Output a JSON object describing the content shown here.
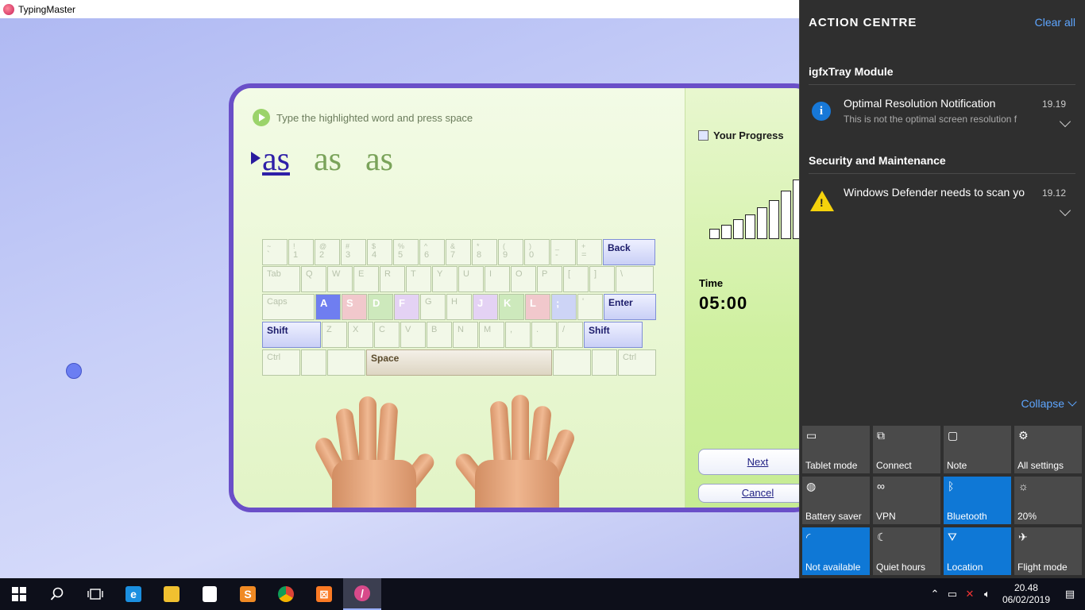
{
  "app": {
    "title": "TypingMaster"
  },
  "lesson": {
    "instruction": "Type the highlighted word and press space",
    "words": [
      "as",
      "as",
      "as"
    ]
  },
  "keyboard": {
    "rows": [
      [
        {
          "top": "~",
          "label": "`"
        },
        {
          "top": "!",
          "label": "1"
        },
        {
          "top": "@",
          "label": "2"
        },
        {
          "top": "#",
          "label": "3"
        },
        {
          "top": "$",
          "label": "4"
        },
        {
          "top": "%",
          "label": "5"
        },
        {
          "top": "^",
          "label": "6"
        },
        {
          "top": "&",
          "label": "7"
        },
        {
          "top": "*",
          "label": "8"
        },
        {
          "top": "(",
          "label": "9"
        },
        {
          "top": ")",
          "label": "0"
        },
        {
          "top": "_",
          "label": "-"
        },
        {
          "top": "+",
          "label": "="
        },
        {
          "label": "Back",
          "cls": "big ww"
        }
      ],
      [
        {
          "label": "Tab",
          "cls": "w"
        },
        {
          "label": "Q"
        },
        {
          "label": "W"
        },
        {
          "label": "E"
        },
        {
          "label": "R"
        },
        {
          "label": "T"
        },
        {
          "label": "Y"
        },
        {
          "label": "U"
        },
        {
          "label": "I"
        },
        {
          "label": "O"
        },
        {
          "label": "P"
        },
        {
          "label": "["
        },
        {
          "label": "]"
        },
        {
          "label": "\\",
          "cls": "w"
        }
      ],
      [
        {
          "label": "Caps",
          "cls": "ww"
        },
        {
          "label": "A",
          "cls": "hl kA"
        },
        {
          "label": "S",
          "cls": "hl kS"
        },
        {
          "label": "D",
          "cls": "hl kD"
        },
        {
          "label": "F",
          "cls": "hl kF"
        },
        {
          "label": "G"
        },
        {
          "label": "H"
        },
        {
          "label": "J",
          "cls": "hl kJ"
        },
        {
          "label": "K",
          "cls": "hl kK"
        },
        {
          "label": "L",
          "cls": "hl kL"
        },
        {
          "label": ";",
          "cls": "hl kSC"
        },
        {
          "label": "'"
        },
        {
          "label": "Enter",
          "cls": "big ww"
        }
      ],
      [
        {
          "label": "Shift",
          "cls": "big www"
        },
        {
          "label": "Z"
        },
        {
          "label": "X"
        },
        {
          "label": "C"
        },
        {
          "label": "V"
        },
        {
          "label": "B"
        },
        {
          "label": "N"
        },
        {
          "label": "M"
        },
        {
          "label": ","
        },
        {
          "label": "."
        },
        {
          "label": "/"
        },
        {
          "label": "Shift",
          "cls": "big www"
        }
      ],
      [
        {
          "label": "Ctrl",
          "cls": "w"
        },
        {
          "label": ""
        },
        {
          "label": "",
          "cls": "w"
        },
        {
          "label": "Space",
          "cls": "space"
        },
        {
          "label": "",
          "cls": "w"
        },
        {
          "label": ""
        },
        {
          "label": "Ctrl",
          "cls": "w"
        }
      ]
    ]
  },
  "progress": {
    "title": "Your Progress",
    "bar_values": [
      1,
      1.4,
      1.9,
      2.4,
      3.1,
      3.8,
      4.7,
      5.8,
      6.8
    ],
    "time_label": "Time",
    "time_value": "05:00",
    "next_label": "Next",
    "cancel_label": "Cancel"
  },
  "action_centre": {
    "title": "ACTION CENTRE",
    "clear_all": "Clear all",
    "groups": [
      {
        "name": "igfxTray Module",
        "notification": {
          "icon": "info-icon",
          "title": "Optimal Resolution Notification",
          "subtitle": "This is not the optimal screen resolution f",
          "time": "19.19"
        }
      },
      {
        "name": "Security and Maintenance",
        "notification": {
          "icon": "warning-icon",
          "title": "Windows Defender needs to scan yo",
          "subtitle": "",
          "time": "19.12"
        }
      }
    ],
    "collapse": "Collapse",
    "tiles": [
      {
        "label": "Tablet mode",
        "icon": "tablet-icon",
        "glyph": "▭",
        "on": false
      },
      {
        "label": "Connect",
        "icon": "connect-icon",
        "glyph": "⧉",
        "on": false
      },
      {
        "label": "Note",
        "icon": "note-icon",
        "glyph": "▢",
        "on": false
      },
      {
        "label": "All settings",
        "icon": "gear-icon",
        "glyph": "⚙",
        "on": false
      },
      {
        "label": "Battery saver",
        "icon": "battery-saver-icon",
        "glyph": "◍",
        "on": false
      },
      {
        "label": "VPN",
        "icon": "vpn-icon",
        "glyph": "∞",
        "on": false
      },
      {
        "label": "Bluetooth",
        "icon": "bluetooth-icon",
        "glyph": "ᛒ",
        "on": true
      },
      {
        "label": "20%",
        "icon": "brightness-icon",
        "glyph": "☼",
        "on": false
      },
      {
        "label": "Not available",
        "icon": "wifi-icon",
        "glyph": "◜",
        "on": true
      },
      {
        "label": "Quiet hours",
        "icon": "moon-icon",
        "glyph": "☾",
        "on": false
      },
      {
        "label": "Location",
        "icon": "location-icon",
        "glyph": "⛛",
        "on": true
      },
      {
        "label": "Flight mode",
        "icon": "airplane-icon",
        "glyph": "✈",
        "on": false
      }
    ]
  },
  "taskbar": {
    "time": "20.48",
    "date": "06/02/2019",
    "apps": [
      {
        "name": "edge-icon",
        "color": "#1b8fe0",
        "glyph": "e"
      },
      {
        "name": "file-explorer-icon",
        "color": "#f0c030",
        "glyph": ""
      },
      {
        "name": "store-icon",
        "color": "#ffffff",
        "glyph": ""
      },
      {
        "name": "sublime-icon",
        "color": "#f08a24",
        "glyph": "S"
      },
      {
        "name": "chrome-icon",
        "color": "#db4437",
        "glyph": ""
      },
      {
        "name": "xampp-icon",
        "color": "#fb7a24",
        "glyph": "⊠"
      },
      {
        "name": "typingmaster-icon",
        "color": "#d84a8a",
        "glyph": "/",
        "active": true
      }
    ]
  },
  "colors": {
    "accent": "#6a4fc8",
    "action_blue": "#0f78d6",
    "link": "#5ea6ff"
  }
}
